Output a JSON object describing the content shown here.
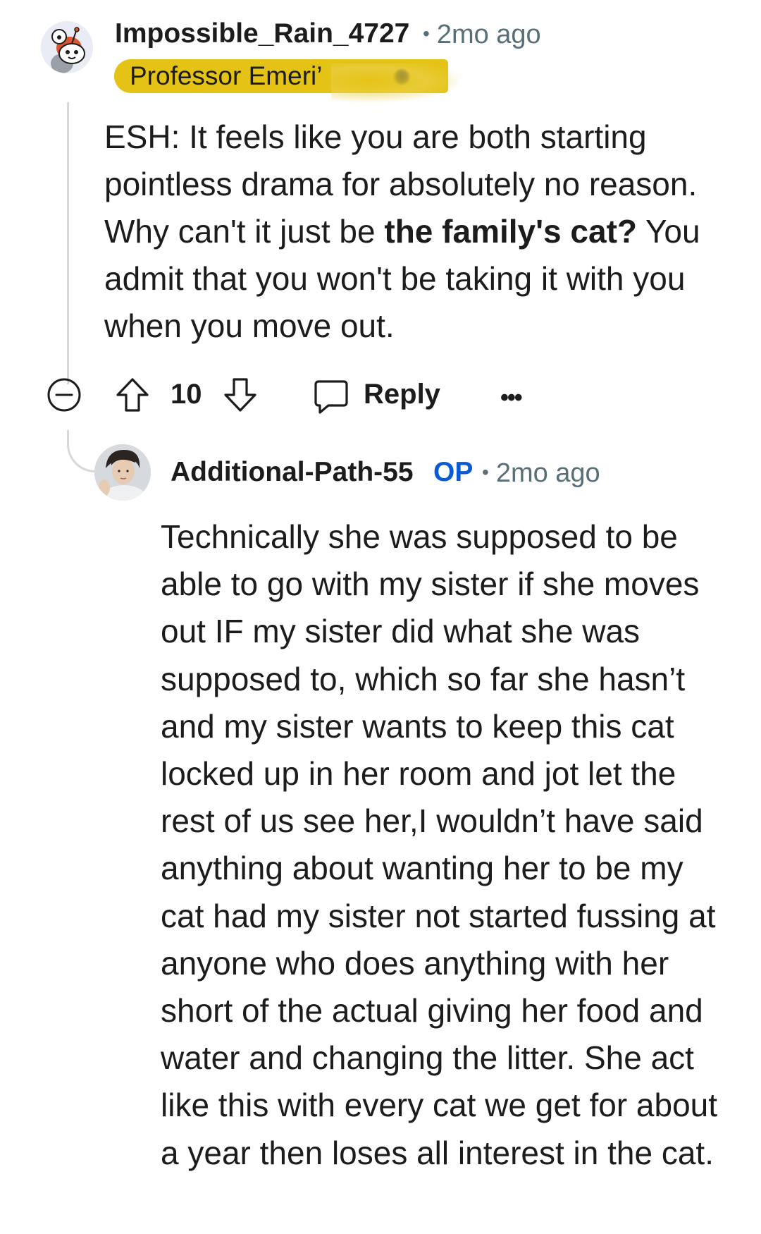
{
  "comments": [
    {
      "username": "Impossible_Rain_4727",
      "separator": "•",
      "timestamp": "2mo ago",
      "flair": "Professor Emeri’",
      "avatar_icon": "snoo-avatar-icon",
      "body_parts": [
        "ESH: It feels like you are both starting pointless drama for absolutely no reason. Why can't it just be ",
        "the family's cat?",
        " You admit that you won't be taking it with you when you move out."
      ],
      "vote_count": "10",
      "reply_label": "Reply",
      "more_label": "•••"
    },
    {
      "username": "Additional-Path-55",
      "op_badge": "OP",
      "separator": "•",
      "timestamp": "2mo ago",
      "avatar_icon": "user-photo-avatar",
      "body": "Technically she was supposed to be able to go with my sister if she moves out IF my sister did what she was supposed to, which so far she hasn’t and my sister wants to keep this cat locked up in her room and jot let the rest of us see her,I wouldn’t have said anything about wanting her to be my cat had my sister not started fussing at anyone who does anything with her short of the actual giving her food and water and changing the litter. She act like this with every cat we get for about a year then loses all interest in the cat."
    }
  ],
  "colors": {
    "flair_background": "#e5c316",
    "op_badge": "#0a5bd3",
    "meta_text": "#576f76",
    "thread_line": "#d8d8d8"
  },
  "icons": [
    "collapse-icon",
    "upvote-icon",
    "downvote-icon",
    "reply-icon",
    "more-options-icon"
  ]
}
